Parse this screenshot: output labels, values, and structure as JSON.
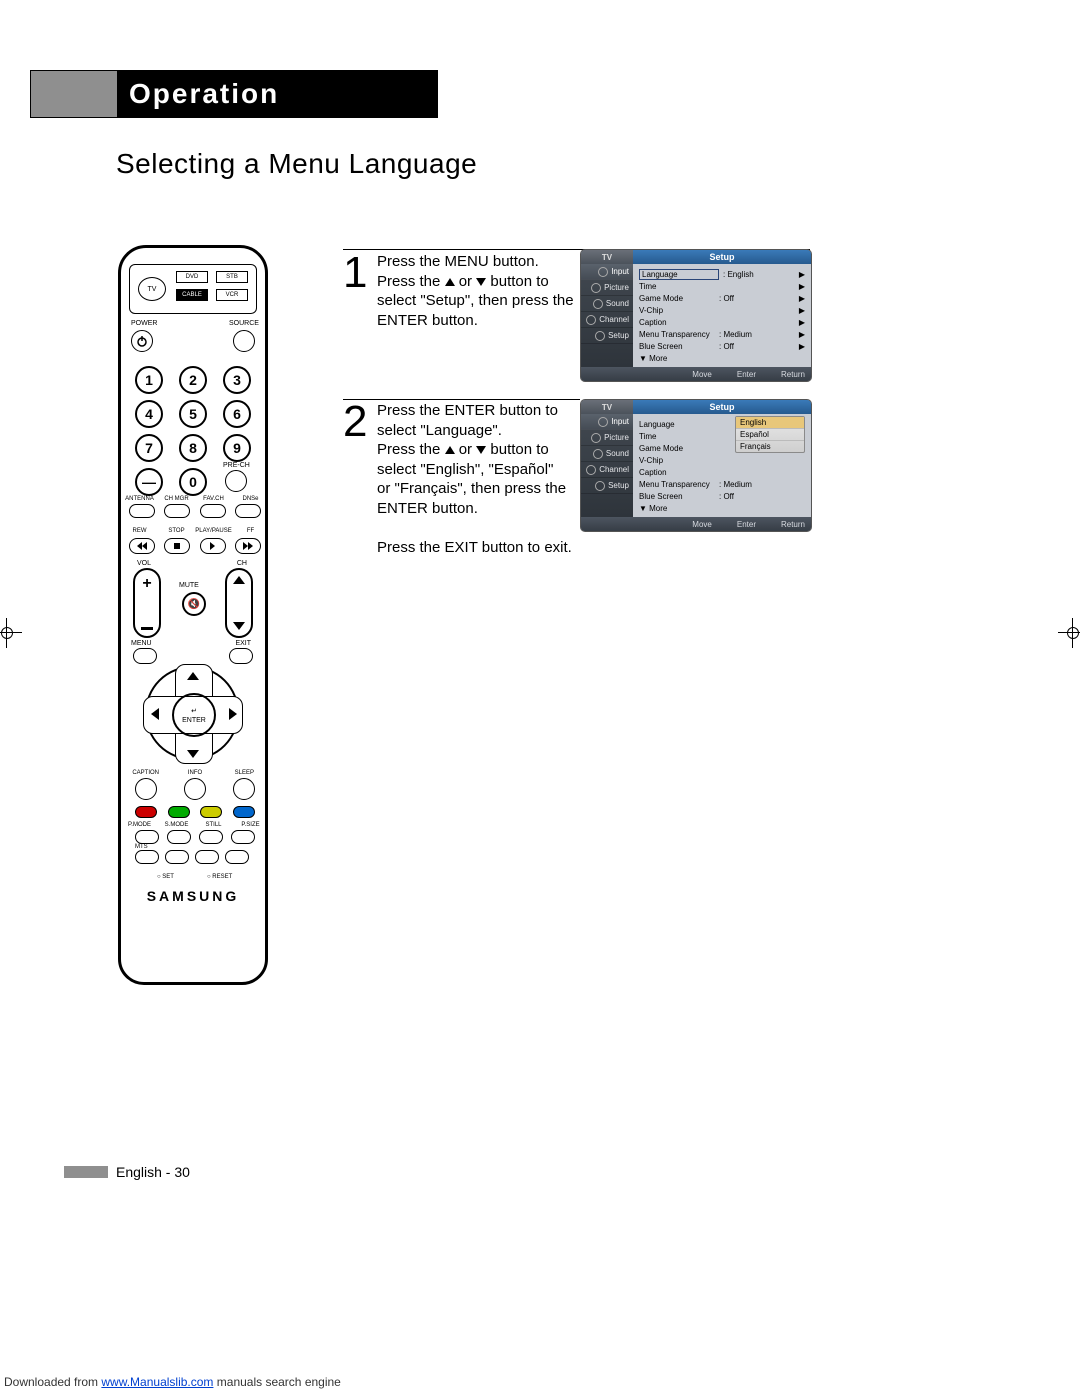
{
  "header": {
    "title": "Operation"
  },
  "page_title": "Selecting a Menu Language",
  "footer": {
    "text": "English - 30"
  },
  "download": {
    "prefix": "Downloaded from ",
    "link": "www.Manualslib.com",
    "suffix": " manuals search engine"
  },
  "remote": {
    "tv": "TV",
    "dvd": "DVD",
    "stb": "STB",
    "cable": "CABLE",
    "vcr": "VCR",
    "power": "POWER",
    "source": "SOURCE",
    "numbers": [
      "1",
      "2",
      "3",
      "4",
      "5",
      "6",
      "7",
      "8",
      "9",
      "0"
    ],
    "dash": "—",
    "prech": "PRE-CH",
    "row2": [
      "ANTENNA",
      "CH MGR",
      "FAV.CH",
      "DNSe"
    ],
    "transport": [
      "REW",
      "STOP",
      "PLAY/PAUSE",
      "FF"
    ],
    "vol": "VOL",
    "ch": "CH",
    "mute": "MUTE",
    "menu": "MENU",
    "exit": "EXIT",
    "enter": "ENTER",
    "row3": [
      "CAPTION",
      "INFO",
      "SLEEP"
    ],
    "row4": [
      "P.MODE",
      "S.MODE",
      "STILL",
      "P.SIZE"
    ],
    "mts": "MTS",
    "set": "SET",
    "reset": "RESET",
    "logo": "SAMSUNG"
  },
  "steps": {
    "s1": {
      "num": "1",
      "l1": "Press the MENU button.",
      "l2a": "Press the ",
      "l2b": " or ",
      "l2c": " button to",
      "l3": "select \"Setup\", then press the",
      "l4": "ENTER button."
    },
    "s2": {
      "num": "2",
      "l1": "Press the ENTER button to",
      "l2": "select \"Language\".",
      "l3a": "Press the ",
      "l3b": " or ",
      "l3c": " button to",
      "l4": "select \"English\", \"Español\"",
      "l5": "or \"Français\", then press the",
      "l6": "ENTER button.",
      "l7": "Press the EXIT button to exit."
    }
  },
  "osd": {
    "tv": "TV",
    "setup": "Setup",
    "side": [
      "Input",
      "Picture",
      "Sound",
      "Channel",
      "Setup"
    ],
    "rows": {
      "language": "Language",
      "language_v": ": English",
      "time": "Time",
      "game": "Game Mode",
      "game_v": ": Off",
      "vchip": "V-Chip",
      "caption": "Caption",
      "menutrans": "Menu Transparency",
      "menutrans_v": ": Medium",
      "blue": "Blue Screen",
      "blue_v": ": Off",
      "more": "▼ More"
    },
    "bottom": {
      "move": "Move",
      "enter": "Enter",
      "return": "Return"
    },
    "langs": [
      "English",
      "Español",
      "Français"
    ]
  }
}
